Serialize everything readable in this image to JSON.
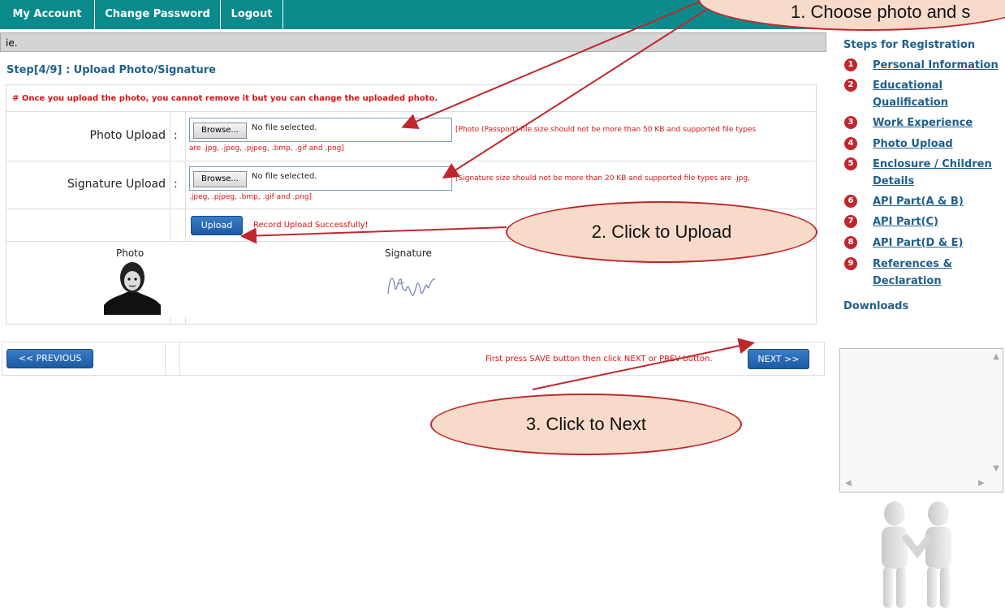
{
  "nav": {
    "my_account": "My Account",
    "change_password": "Change Password",
    "logout": "Logout"
  },
  "message_bar": "ie.",
  "step_title": "Step[4/9] : Upload Photo/Signature",
  "note": "# Once you upload the photo, you cannot remove it but you can change the uploaded photo.",
  "photo_row": {
    "label": "Photo Upload",
    "colon": ":",
    "browse": "Browse...",
    "no_file": "No file selected.",
    "hint_line1": "[Photo (Passport) file size should not be more than 50 KB and supported file types",
    "hint_line2": "are .jpg, .jpeg, .pjpeg, .bmp, .gif and .png]"
  },
  "signature_row": {
    "label": "Signature Upload",
    "colon": ":",
    "browse": "Browse...",
    "no_file": "No file selected.",
    "hint_line1": "[Signature size should not be more than 20 KB and supported file types are .jpg,",
    "hint_line2": ".jpeg, .pjpeg, .bmp, .gif and .png]"
  },
  "upload_button": "Upload",
  "success_message": "Record Upload Successfully!",
  "preview": {
    "photo_caption": "Photo",
    "signature_caption": "Signature"
  },
  "sidebar": {
    "heading": "Steps for Registration",
    "steps": [
      {
        "num": "1",
        "label": "Personal Information"
      },
      {
        "num": "2",
        "label": "Educational Qualification"
      },
      {
        "num": "3",
        "label": "Work Experience"
      },
      {
        "num": "4",
        "label": "Photo Upload"
      },
      {
        "num": "5",
        "label": "Enclosure / Children Details"
      },
      {
        "num": "6",
        "label": "API Part(A & B)"
      },
      {
        "num": "7",
        "label": "API Part(C)"
      },
      {
        "num": "8",
        "label": "API Part(D & E)"
      },
      {
        "num": "9",
        "label": "References & Declaration"
      }
    ],
    "downloads": "Downloads"
  },
  "bottom_nav": {
    "previous": "<< PREVIOUS",
    "hint": "First press SAVE button then click NEXT or PREV button.",
    "next": "NEXT >>"
  },
  "callouts": {
    "one": "1. Choose photo and s",
    "two": "2. Click to Upload",
    "three": "3. Click to Next"
  },
  "colors": {
    "nav_bg": "#0a8a8a",
    "accent_red": "#c0272d",
    "link_blue": "#1f5f8c",
    "callout_fill": "#f7dac9"
  }
}
